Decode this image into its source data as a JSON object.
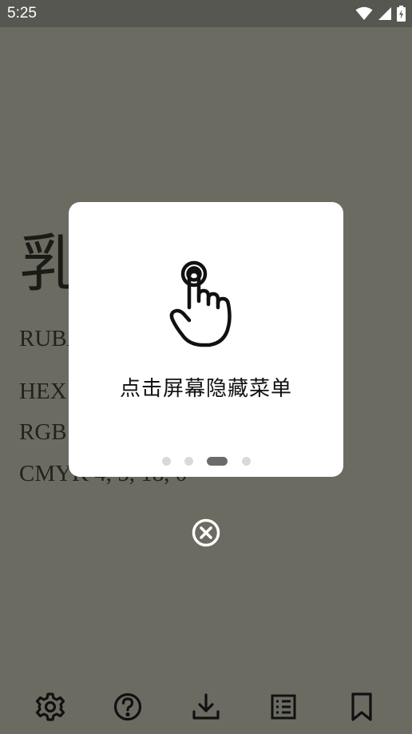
{
  "status_bar": {
    "time": "5:25",
    "icons": [
      "wifi-icon",
      "signal-icon",
      "battery-icon"
    ]
  },
  "color_info": {
    "name": "乳",
    "roman": "RUBA",
    "hex": "HEX",
    "rgb": "RGB",
    "cmyk": "CMYK  4, 5, 18, 0"
  },
  "dialog": {
    "icon": "tap-hand-icon",
    "message": "点击屏幕隐藏菜单",
    "page_count": 4,
    "active_page": 3
  },
  "close_button": {
    "icon": "close-circle-icon"
  },
  "toolbar": {
    "items": [
      "settings-icon",
      "help-icon",
      "download-icon",
      "list-icon",
      "bookmark-icon"
    ]
  },
  "colors": {
    "overlay_background": "#6c6b62",
    "status_bar": "#575751",
    "dialog_background": "#ffffff",
    "dot_inactive": "#d9d9d9",
    "dot_active": "#6b6b6b"
  }
}
